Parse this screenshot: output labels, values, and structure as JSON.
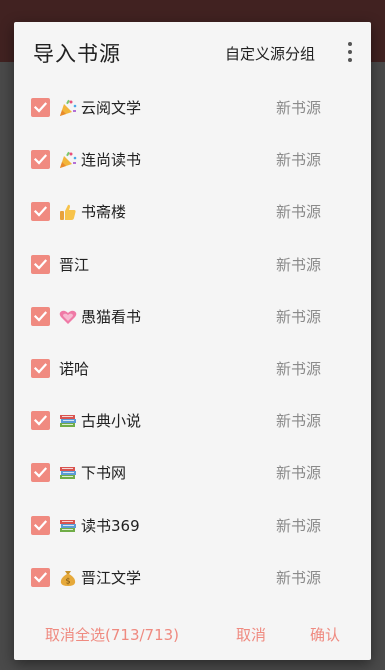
{
  "dialog": {
    "title": "导入书源",
    "group_button": "自定义源分组",
    "more_icon": "more-vert-icon"
  },
  "items": [
    {
      "name": "云阅文学",
      "icon": "party-popper-icon",
      "tag": "新书源",
      "checked": true
    },
    {
      "name": "连尚读书",
      "icon": "party-popper-icon",
      "tag": "新书源",
      "checked": true
    },
    {
      "name": "书斋楼",
      "icon": "thumbs-up-icon",
      "tag": "新书源",
      "checked": true
    },
    {
      "name": "晋江",
      "icon": "",
      "tag": "新书源",
      "checked": true
    },
    {
      "name": "愚猫看书",
      "icon": "sparkling-heart-icon",
      "tag": "新书源",
      "checked": true
    },
    {
      "name": "诺哈",
      "icon": "",
      "tag": "新书源",
      "checked": true
    },
    {
      "name": "古典小说",
      "icon": "books-icon",
      "tag": "新书源",
      "checked": true
    },
    {
      "name": "下书网",
      "icon": "books-icon",
      "tag": "新书源",
      "checked": true
    },
    {
      "name": "读书369",
      "icon": "books-icon",
      "tag": "新书源",
      "checked": true
    },
    {
      "name": "晋江文学",
      "icon": "money-bag-icon",
      "tag": "新书源",
      "checked": true
    }
  ],
  "footer": {
    "deselect_all": "取消全选(713/713)",
    "cancel": "取消",
    "confirm": "确认"
  },
  "colors": {
    "accent": "#f08a80",
    "topbar": "#412221"
  }
}
